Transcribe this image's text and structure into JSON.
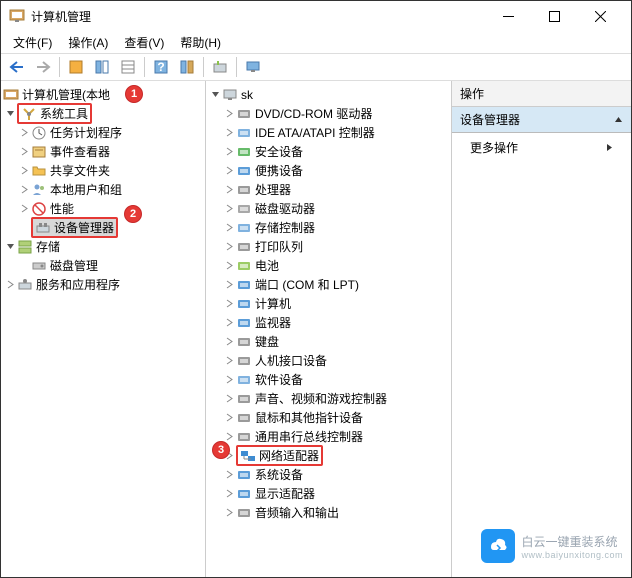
{
  "window": {
    "title": "计算机管理"
  },
  "menubar": {
    "file": "文件(F)",
    "action": "操作(A)",
    "view": "查看(V)",
    "help": "帮助(H)"
  },
  "left_tree": {
    "root": "计算机管理(本地",
    "system_tools": "系统工具",
    "task_scheduler": "任务计划程序",
    "event_viewer": "事件查看器",
    "shared_folders": "共享文件夹",
    "local_users": "本地用户和组",
    "performance": "性能",
    "device_manager": "设备管理器",
    "storage": "存储",
    "disk_management": "磁盘管理",
    "services_apps": "服务和应用程序"
  },
  "mid_tree": {
    "root": "sk",
    "items": [
      "DVD/CD-ROM 驱动器",
      "IDE ATA/ATAPI 控制器",
      "安全设备",
      "便携设备",
      "处理器",
      "磁盘驱动器",
      "存储控制器",
      "打印队列",
      "电池",
      "端口 (COM 和 LPT)",
      "计算机",
      "监视器",
      "键盘",
      "人机接口设备",
      "软件设备",
      "声音、视频和游戏控制器",
      "鼠标和其他指针设备",
      "通用串行总线控制器",
      "网络适配器",
      "系统设备",
      "显示适配器",
      "音频输入和输出"
    ]
  },
  "right_pane": {
    "header": "操作",
    "section": "设备管理器",
    "more_actions": "更多操作"
  },
  "callouts": {
    "c1": "1",
    "c2": "2",
    "c3": "3"
  },
  "watermark": {
    "brand": "白云一键重装系统",
    "url": "www.baiyunxitong.com"
  },
  "icons": {
    "dvd": "#888",
    "ide": "#6aa4d9",
    "security": "#4caf50",
    "portable": "#3f8cd1",
    "cpu": "#888",
    "disk": "#999",
    "storage": "#6aa4d9",
    "print": "#888",
    "battery": "#8bc34a",
    "port": "#3f8cd1",
    "computer": "#3f8cd1",
    "monitor": "#3f8cd1",
    "keyboard": "#888",
    "hid": "#888",
    "software": "#6aa4d9",
    "sound": "#888",
    "mouse": "#888",
    "usb": "#888",
    "network": "#3f8cd1",
    "system": "#3f8cd1",
    "display": "#3f8cd1",
    "audio": "#888"
  }
}
